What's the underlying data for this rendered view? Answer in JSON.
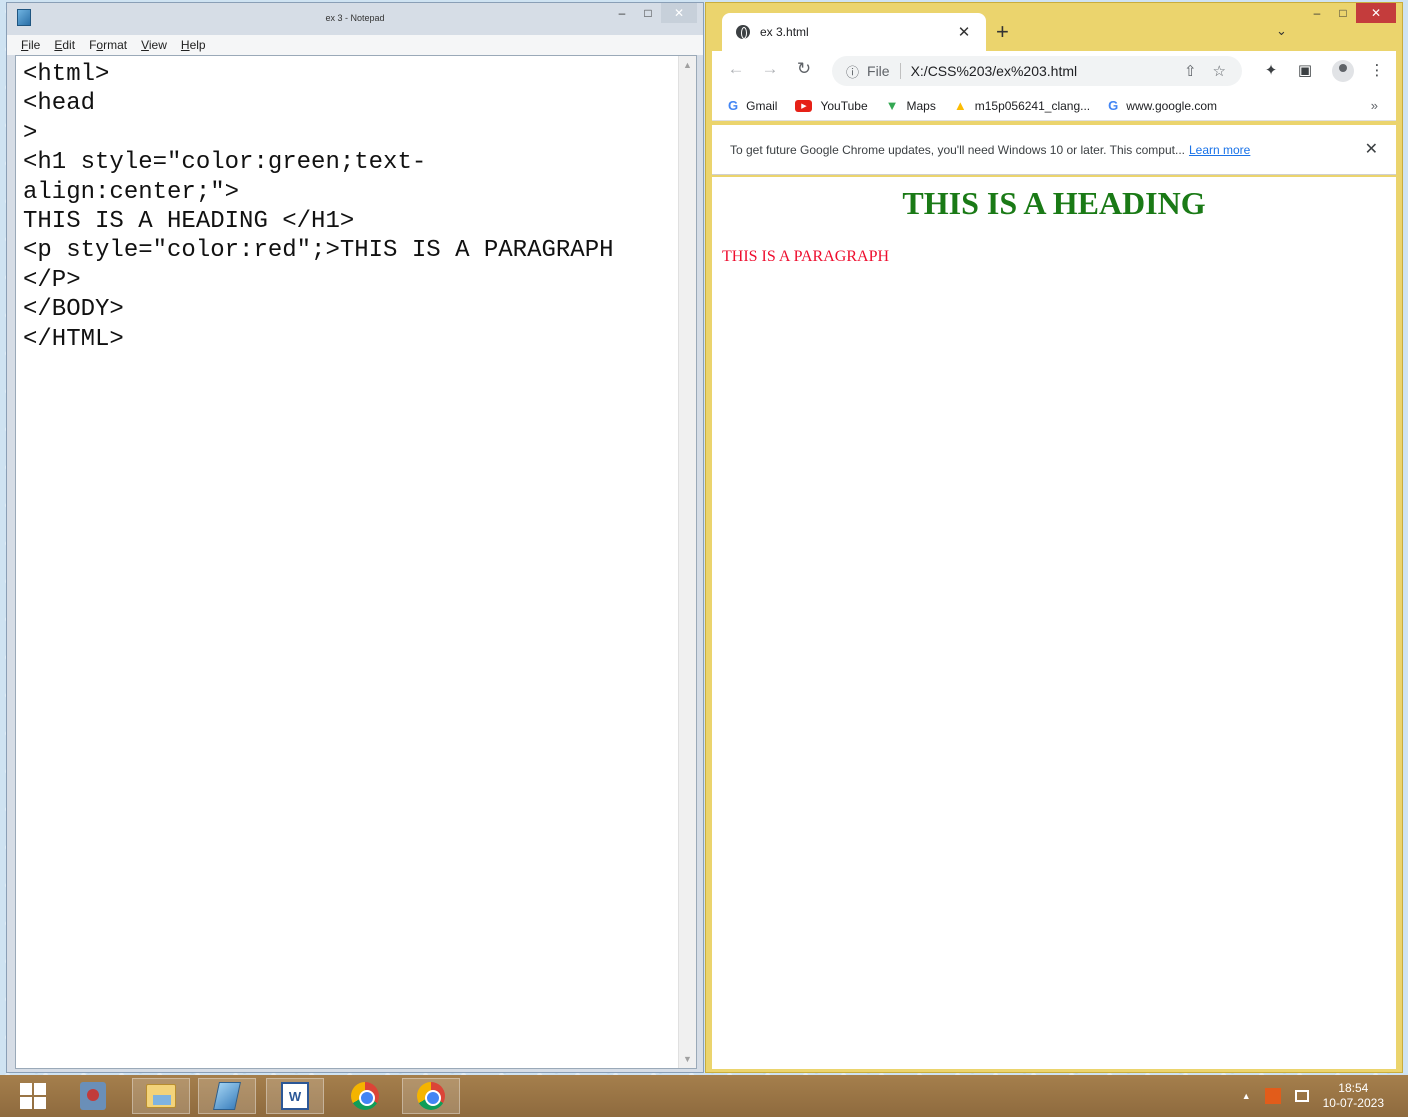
{
  "notepad": {
    "title": "ex 3 - Notepad",
    "menu": [
      {
        "key": "F",
        "rest": "ile"
      },
      {
        "key": "E",
        "rest": "dit"
      },
      {
        "pre": "F",
        "key": "o",
        "rest": "rmat"
      },
      {
        "key": "V",
        "rest": "iew"
      },
      {
        "key": "H",
        "rest": "elp"
      }
    ],
    "text": "<html>\n<head\n>\n<h1 style=\"color:green;text-\nalign:center;\">\nTHIS IS A HEADING </H1>\n<p style=\"color:red\";>THIS IS A PARAGRAPH\n</P>\n</BODY>\n</HTML>"
  },
  "chrome": {
    "tab_title": "ex 3.html",
    "omnibox": {
      "scheme_label": "File",
      "url": "X:/CSS%203/ex%203.html"
    },
    "bookmarks": [
      {
        "label": "Gmail",
        "icon": "google-g-icon"
      },
      {
        "label": "YouTube",
        "icon": "youtube-icon"
      },
      {
        "label": "Maps",
        "icon": "maps-pin-icon"
      },
      {
        "label": "m15p056241_clang...",
        "icon": "google-drive-icon"
      },
      {
        "label": "www.google.com",
        "icon": "google-g-icon"
      }
    ],
    "infobar": {
      "message": "To get future Google Chrome updates, you'll need Windows 10 or later. This comput...",
      "link": "Learn more"
    },
    "page": {
      "heading": "THIS IS A HEADING",
      "heading_color": "#1a7a16",
      "paragraph": "THIS IS A PARAGRAPH",
      "paragraph_color": "#ee0d2e"
    }
  },
  "taskbar": {
    "apps": [
      "start-icon",
      "game-icon",
      "file-explorer-icon",
      "notepad-icon",
      "word-icon",
      "chrome-icon",
      "chrome-icon"
    ],
    "clock": {
      "time": "18:54",
      "date": "10-07-2023"
    }
  },
  "colors": {
    "chrome_frame": "#ebd46d",
    "close_button": "#c43c3c",
    "taskbar": "#9a7545"
  }
}
